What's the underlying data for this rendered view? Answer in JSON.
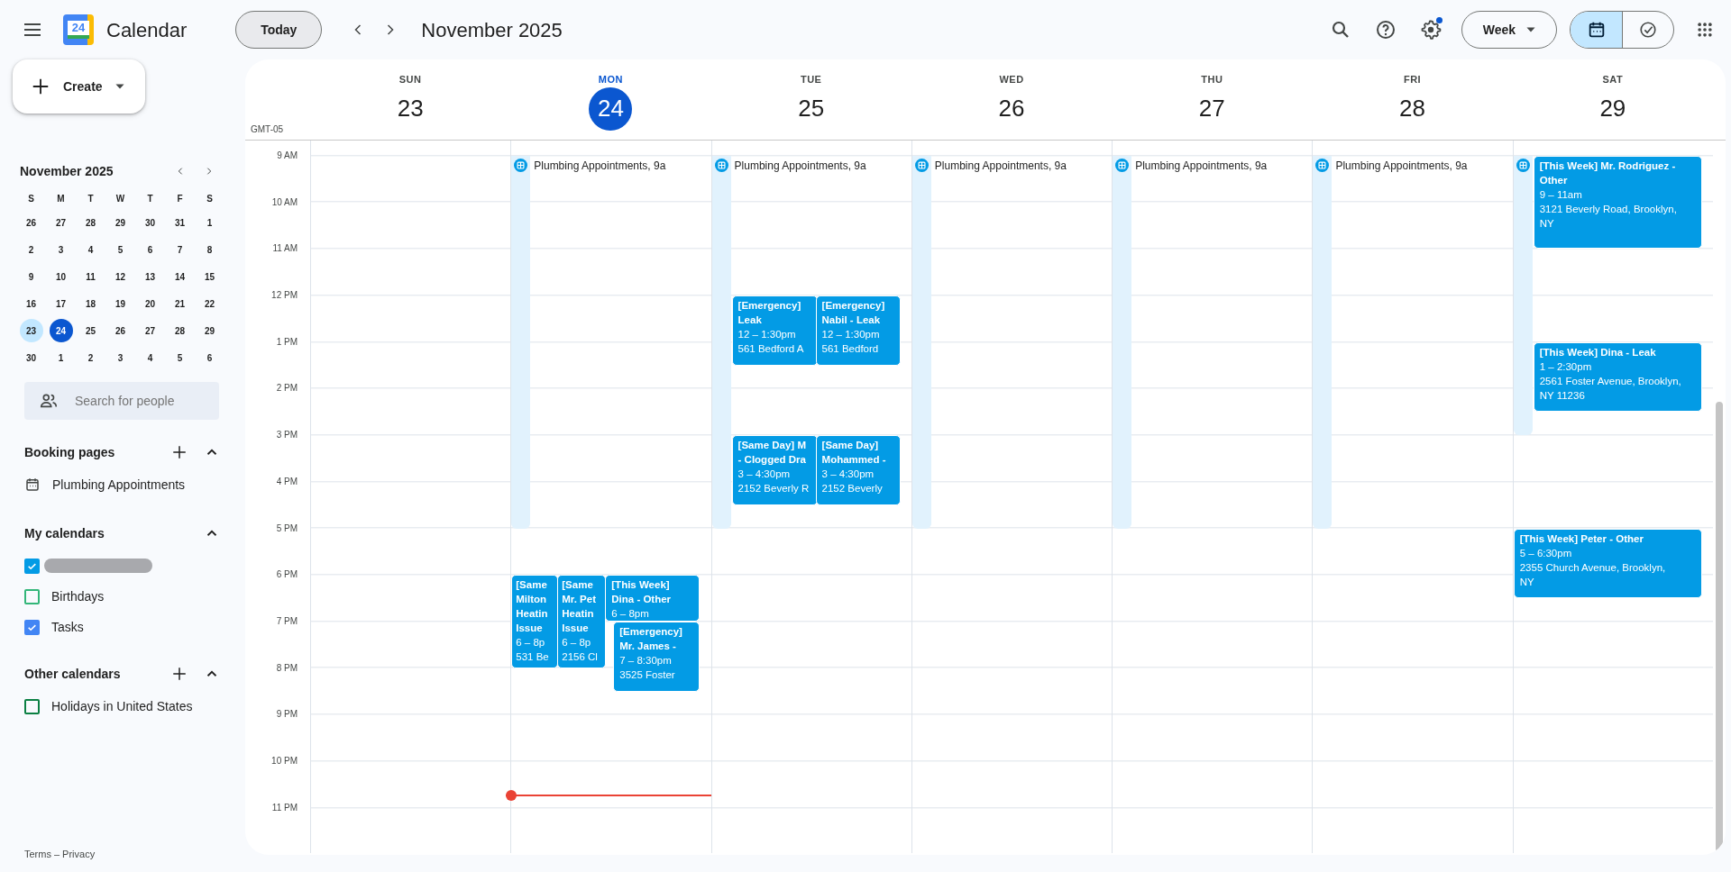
{
  "header": {
    "app_name": "Calendar",
    "logo_text": "24",
    "today_button": "Today",
    "period_title": "November 2025",
    "settings_badge": true,
    "view_dropdown": "Week",
    "view_toggle": [
      {
        "kind": "calendar",
        "selected": true
      },
      {
        "kind": "tasks",
        "selected": false
      }
    ]
  },
  "sidebar": {
    "create_button": "Create",
    "mini_calendar": {
      "month": "November 2025",
      "weekdays": [
        "S",
        "M",
        "T",
        "W",
        "T",
        "F",
        "S"
      ],
      "weeks": [
        [
          {
            "label": "26",
            "selected": false,
            "today": false
          },
          {
            "label": "27",
            "selected": false,
            "today": false
          },
          {
            "label": "28",
            "selected": false,
            "today": false
          },
          {
            "label": "29",
            "selected": false,
            "today": false
          },
          {
            "label": "30",
            "selected": false,
            "today": false
          },
          {
            "label": "31",
            "selected": false,
            "today": false
          },
          {
            "label": "1",
            "selected": false,
            "today": false
          }
        ],
        [
          {
            "label": "2",
            "selected": false,
            "today": false
          },
          {
            "label": "3",
            "selected": false,
            "today": false
          },
          {
            "label": "4",
            "selected": false,
            "today": false
          },
          {
            "label": "5",
            "selected": false,
            "today": false
          },
          {
            "label": "6",
            "selected": false,
            "today": false
          },
          {
            "label": "7",
            "selected": false,
            "today": false
          },
          {
            "label": "8",
            "selected": false,
            "today": false
          }
        ],
        [
          {
            "label": "9",
            "selected": false,
            "today": false
          },
          {
            "label": "10",
            "selected": false,
            "today": false
          },
          {
            "label": "11",
            "selected": false,
            "today": false
          },
          {
            "label": "12",
            "selected": false,
            "today": false
          },
          {
            "label": "13",
            "selected": false,
            "today": false
          },
          {
            "label": "14",
            "selected": false,
            "today": false
          },
          {
            "label": "15",
            "selected": false,
            "today": false
          }
        ],
        [
          {
            "label": "16",
            "selected": false,
            "today": false
          },
          {
            "label": "17",
            "selected": false,
            "today": false
          },
          {
            "label": "18",
            "selected": false,
            "today": false
          },
          {
            "label": "19",
            "selected": false,
            "today": false
          },
          {
            "label": "20",
            "selected": false,
            "today": false
          },
          {
            "label": "21",
            "selected": false,
            "today": false
          },
          {
            "label": "22",
            "selected": false,
            "today": false
          }
        ],
        [
          {
            "label": "23",
            "selected": true,
            "today": false
          },
          {
            "label": "24",
            "selected": false,
            "today": true
          },
          {
            "label": "25",
            "selected": false,
            "today": false
          },
          {
            "label": "26",
            "selected": false,
            "today": false
          },
          {
            "label": "27",
            "selected": false,
            "today": false
          },
          {
            "label": "28",
            "selected": false,
            "today": false
          },
          {
            "label": "29",
            "selected": false,
            "today": false
          }
        ],
        [
          {
            "label": "30",
            "selected": false,
            "today": false
          },
          {
            "label": "1",
            "selected": false,
            "today": false
          },
          {
            "label": "2",
            "selected": false,
            "today": false
          },
          {
            "label": "3",
            "selected": false,
            "today": false
          },
          {
            "label": "4",
            "selected": false,
            "today": false
          },
          {
            "label": "5",
            "selected": false,
            "today": false
          },
          {
            "label": "6",
            "selected": false,
            "today": false
          }
        ]
      ]
    },
    "search_placeholder": "Search for people",
    "booking_pages": {
      "title": "Booking pages",
      "expanded": true,
      "items": [
        {
          "label": "Plumbing Appointments"
        }
      ]
    },
    "my_calendars": {
      "title": "My calendars",
      "expanded": true,
      "items": [
        {
          "kind": "redacted",
          "checked": true,
          "color": "#039be5"
        },
        {
          "kind": "calendar",
          "label": "Birthdays",
          "checked": false,
          "color": "#33b679"
        },
        {
          "kind": "calendar",
          "label": "Tasks",
          "checked": true,
          "color": "#4285f4"
        }
      ]
    },
    "other_calendars": {
      "title": "Other calendars",
      "expanded": true,
      "items": [
        {
          "kind": "calendar",
          "label": "Holidays in United States",
          "checked": false,
          "color": "#0b8043"
        }
      ]
    },
    "footer": [
      "Terms",
      "–",
      "Privacy"
    ]
  },
  "week": {
    "timezone": "GMT-05",
    "hours": [
      "9 AM",
      "10 AM",
      "11 AM",
      "12 PM",
      "1 PM",
      "2 PM",
      "3 PM",
      "4 PM",
      "5 PM",
      "6 PM",
      "7 PM",
      "8 PM",
      "9 PM",
      "10 PM",
      "11 PM"
    ],
    "days": [
      {
        "name": "SUN",
        "number": "23",
        "today": false
      },
      {
        "name": "MON",
        "number": "24",
        "today": true,
        "booking_slot": {
          "kind": "labeled",
          "label": "Plumbing Appointments, 9a"
        },
        "events": [
          {
            "title": "[Same\nMilton\nHeatin\nIssue",
            "time": "6 – 8p",
            "location": "531 Be"
          },
          {
            "title": "[Same\nMr. Pet\nHeatin\nIssue",
            "time": "6 – 8p",
            "location": "2156 Cl"
          },
          {
            "title": "[This Week]\nDina - Other",
            "time": "6 – 8pm"
          },
          {
            "title": "[Emergency]\nMr. James -",
            "time": "7 – 8:30pm",
            "location": "3525 Foster"
          }
        ]
      },
      {
        "name": "TUE",
        "number": "25",
        "today": false,
        "booking_slot": {
          "kind": "labeled",
          "label": "Plumbing Appointments, 9a"
        },
        "events": [
          {
            "title": "[Emergency]\nLeak",
            "time": "12 – 1:30pm",
            "location": "561 Bedford A"
          },
          {
            "title": "[Emergency]\nNabil - Leak",
            "time": "12 – 1:30pm",
            "location": "561 Bedford"
          },
          {
            "title": "[Same Day] M\n- Clogged Dra",
            "time": "3 – 4:30pm",
            "location": "2152 Beverly R"
          },
          {
            "title": "[Same Day]\nMohammed -",
            "time": "3 – 4:30pm",
            "location": "2152 Beverly"
          }
        ]
      },
      {
        "name": "WED",
        "number": "26",
        "today": false,
        "booking_slot": {
          "kind": "labeled",
          "label": "Plumbing Appointments, 9a"
        }
      },
      {
        "name": "THU",
        "number": "27",
        "today": false,
        "booking_slot": {
          "kind": "labeled",
          "label": "Plumbing Appointments, 9a"
        }
      },
      {
        "name": "FRI",
        "number": "28",
        "today": false,
        "booking_slot": {
          "kind": "labeled",
          "label": "Plumbing Appointments, 9a"
        }
      },
      {
        "name": "SAT",
        "number": "29",
        "today": false,
        "booking_slot": {
          "kind": "covered"
        },
        "events": [
          {
            "title": "[This Week] Mr. Rodriguez -\nOther",
            "time": "9 – 11am",
            "location": "3121 Beverly Road, Brooklyn,\nNY"
          },
          {
            "title": "[This Week] Dina - Leak",
            "time": "1 – 2:30pm",
            "location": "2561 Foster Avenue, Brooklyn,\nNY 11236"
          },
          {
            "title": "[This Week] Peter - Other",
            "time": "5 – 6:30pm",
            "location": "2355 Church Avenue, Brooklyn,\nNY"
          }
        ]
      }
    ]
  }
}
